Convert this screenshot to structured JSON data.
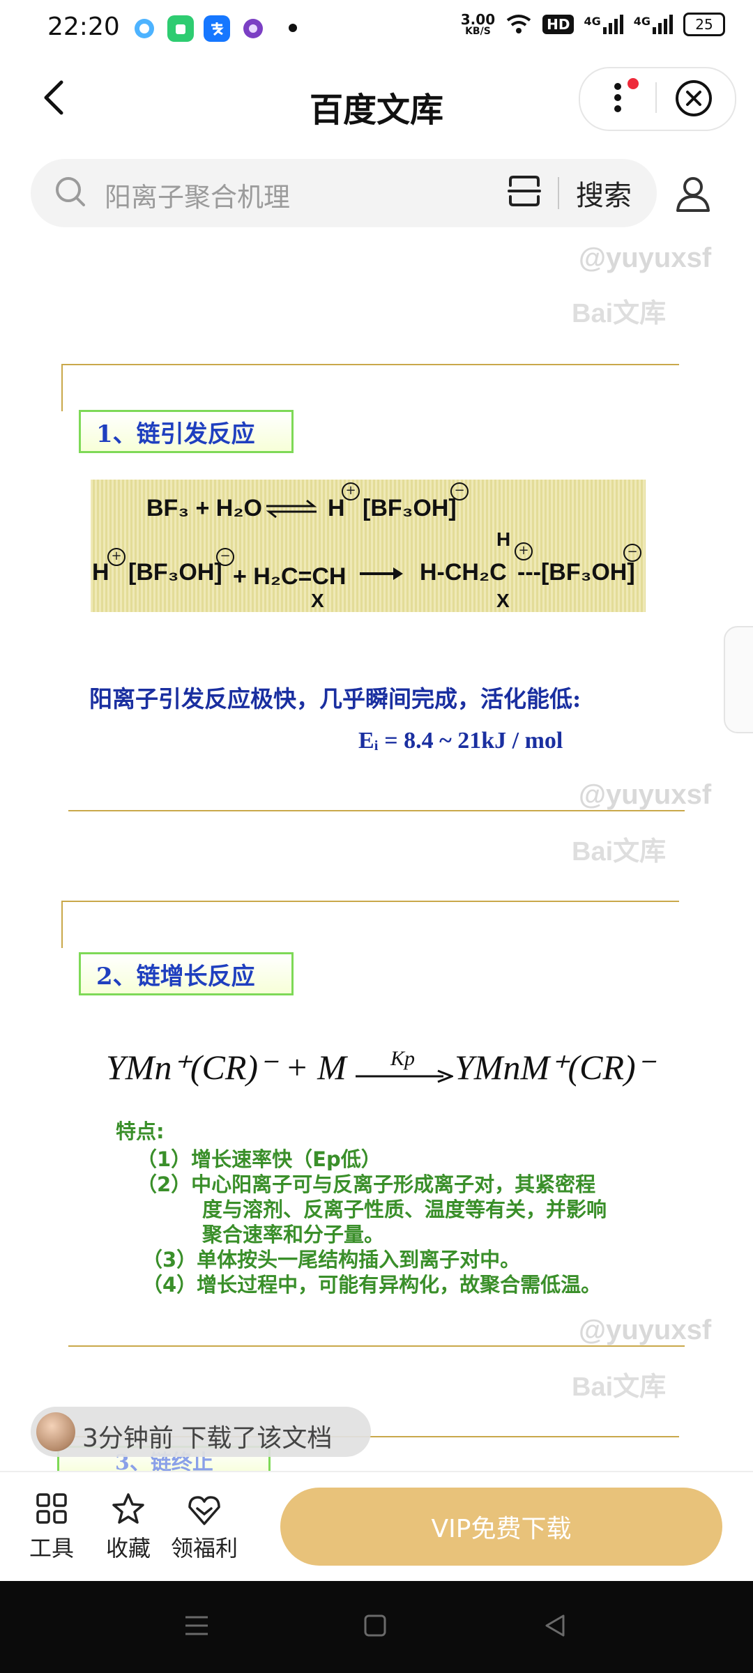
{
  "status_bar": {
    "time": "22:20",
    "speed_value": "3.00",
    "speed_unit": "KB/S",
    "hd_label": "HD",
    "net1": "4G",
    "net2": "4G",
    "battery": "25"
  },
  "nav": {
    "title": "百度文库"
  },
  "search": {
    "placeholder": "阳离子聚合机理",
    "button_label": "搜索"
  },
  "watermark": {
    "name": "@yuyuxsf",
    "logo": "Bai文库"
  },
  "slide1": {
    "heading": "1、链引发反应",
    "reaction1_left": "BF₃ + H₂O",
    "reaction1_right": "H",
    "reaction1_anion": "[BF₃OH]",
    "reaction2_cation": "H",
    "reaction2_anion": "[BF₃OH]",
    "reaction2_monomer": "+ H₂C=CH",
    "reaction2_sub": "X",
    "reaction2_product": "H-CH₂C",
    "reaction2_product_top": "H",
    "reaction2_product_sub": "X",
    "reaction2_product_anion": "---[BF₃OH]",
    "note": "阳离子引发反应极快，几乎瞬间完成，活化能低:",
    "formula": "Eᵢ = 8.4 ~ 21kJ / mol"
  },
  "slide2": {
    "heading": "2、链增长反应",
    "equation_left": "YMn⁺(CR)⁻ + M",
    "equation_arrow_label": "Kp",
    "equation_right": "YMnM⁺(CR)⁻",
    "features_title": "特点:",
    "features": [
      "（1）增长速率快（Ep低）",
      "（2）中心阳离子可与反离子形成离子对，其紧密程",
      "度与溶剂、反离子性质、温度等有关，并影响",
      "聚合速率和分子量。",
      "（3）单体按头一尾结构插入到离子对中。",
      "（4）增长过程中，可能有异构化，故聚合需低温。"
    ]
  },
  "slide3": {
    "heading_partial": "3、链终止"
  },
  "toast": {
    "text": "3分钟前  下载了该文档"
  },
  "toolbar": {
    "tools_label": "工具",
    "favorite_label": "收藏",
    "welfare_label": "领福利",
    "vip_button": "VIP免费下载"
  },
  "colors": {
    "vip": "#e8c27a",
    "heading_blue": "#1f3fbf",
    "green_text": "#3a8f2a",
    "gold_line": "#c9a84a"
  }
}
